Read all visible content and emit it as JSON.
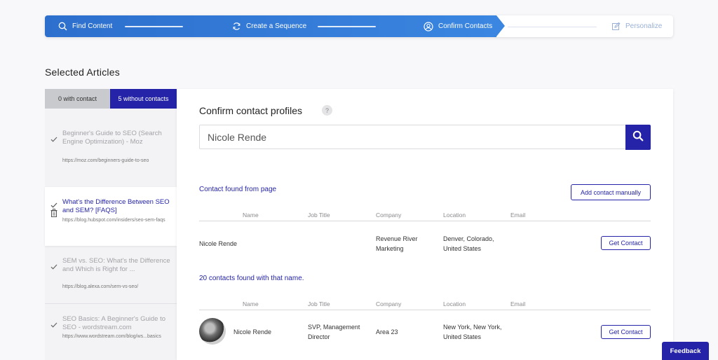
{
  "stepper": {
    "steps": [
      {
        "label": "Find Content",
        "icon": "search-icon",
        "state": "active"
      },
      {
        "label": "Create a Sequence",
        "icon": "refresh-icon",
        "state": "active"
      },
      {
        "label": "Confirm Contacts",
        "icon": "user-circle-icon",
        "state": "current"
      },
      {
        "label": "Personalize",
        "icon": "edit-icon",
        "state": "inactive"
      }
    ]
  },
  "selected_articles": {
    "title": "Selected Articles",
    "tabs": {
      "with_contact": "0 with contact",
      "without_contacts": "5 without contacts"
    },
    "articles": [
      {
        "title": "Beginner's Guide to SEO (Search Engine Optimization) - Moz",
        "url": "https://moz.com/beginners-guide-to-seo",
        "active": false
      },
      {
        "title": "What's the Difference Between SEO and SEM? [FAQS]",
        "url": "https://blog.hubspot.com/insiders/seo-sem-faqs",
        "active": true
      },
      {
        "title": "SEM vs. SEO: What's the Difference and Which is Right for ...",
        "url": "https://blog.alexa.com/sem-vs-seo/",
        "active": false
      },
      {
        "title": "SEO Basics: A Beginner's Guide to SEO - wordstream.com",
        "url": "https://www.wordstream.com/blog/ws...basics",
        "active": false
      }
    ]
  },
  "confirm": {
    "title": "Confirm contact profiles",
    "help": "?",
    "search_value": "Nicole Rende",
    "found_title": "Contact found from page",
    "add_manual": "Add contact manually",
    "columns": {
      "name": "Name",
      "job": "Job Title",
      "company": "Company",
      "location": "Location",
      "email": "Email"
    },
    "page_contact": {
      "name": "Nicole Rende",
      "job": "",
      "company": "Revenue River Marketing",
      "location": "Denver, Colorado, United States",
      "email": "",
      "action": "Get Contact"
    },
    "name_results_title": "20 contacts found with that name.",
    "name_contacts": [
      {
        "name": "Nicole Rende",
        "job": "SVP, Management Director",
        "company": "Area 23",
        "location": "New York, New York, United States",
        "email": "",
        "action": "Get Contact"
      }
    ]
  },
  "feedback": "Feedback",
  "colors": {
    "accent": "#2524a8",
    "stepper_blue": "#3a86e0"
  }
}
